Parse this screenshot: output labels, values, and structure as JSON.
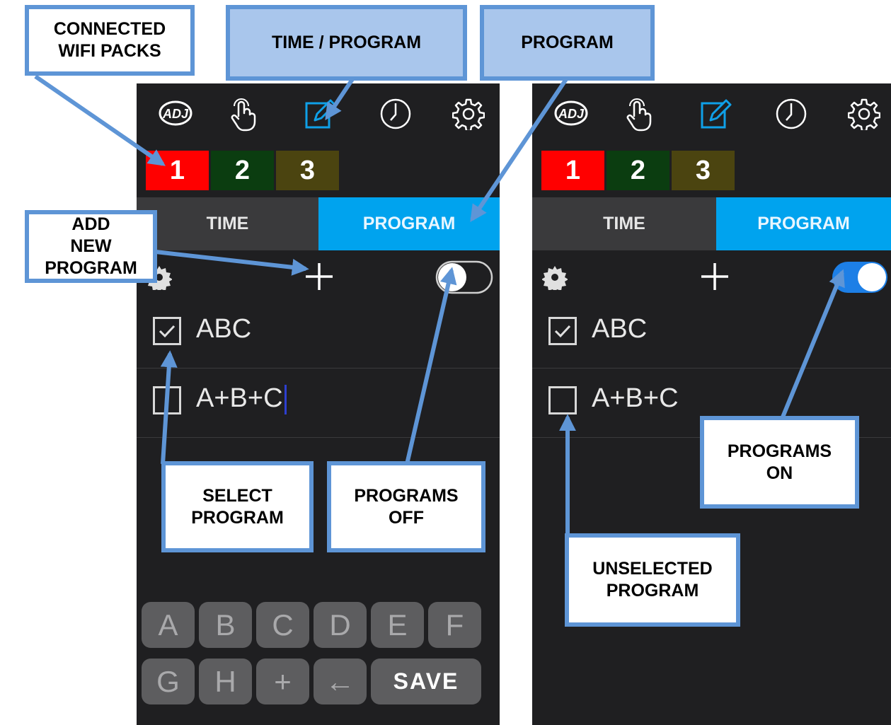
{
  "colors": {
    "accent": "#00a3ee",
    "callout_border": "#5e95d6",
    "pack1": "#ff0000",
    "pack2": "#0b3d10",
    "pack3": "#4b4410",
    "toggle_on": "#1d7fe6"
  },
  "callouts": {
    "connected_packs": "CONNECTED\nWIFI PACKS",
    "time_program": "TIME / PROGRAM",
    "program": "PROGRAM",
    "add_new_program": "ADD\nNEW\nPROGRAM",
    "select_program": "SELECT\nPROGRAM",
    "programs_off": "PROGRAMS\nOFF",
    "programs_on": "PROGRAMS\nON",
    "unselected_program": "UNSELECTED\nPROGRAM"
  },
  "left_screen": {
    "icons": [
      "adj-logo-icon",
      "touch-hand-icon",
      "edit-pencil-icon",
      "clock-icon",
      "settings-gear-icon"
    ],
    "packs": [
      "1",
      "2",
      "3"
    ],
    "tabs": {
      "time": "TIME",
      "program": "PROGRAM",
      "active": "program"
    },
    "programs_enabled": false,
    "programs": [
      {
        "name": "ABC",
        "checked": true
      },
      {
        "name": "A+B+C",
        "checked": false
      }
    ],
    "keyboard": {
      "row1": [
        "A",
        "B",
        "C",
        "D",
        "E",
        "F"
      ],
      "row2": [
        "G",
        "H",
        "+",
        "←",
        "SAVE"
      ]
    }
  },
  "right_screen": {
    "icons": [
      "adj-logo-icon",
      "touch-hand-icon",
      "edit-pencil-icon",
      "clock-icon",
      "settings-gear-icon"
    ],
    "packs": [
      "1",
      "2",
      "3"
    ],
    "tabs": {
      "time": "TIME",
      "program": "PROGRAM",
      "active": "program"
    },
    "programs_enabled": true,
    "programs": [
      {
        "name": "ABC",
        "checked": true
      },
      {
        "name": "A+B+C",
        "checked": false
      }
    ]
  }
}
